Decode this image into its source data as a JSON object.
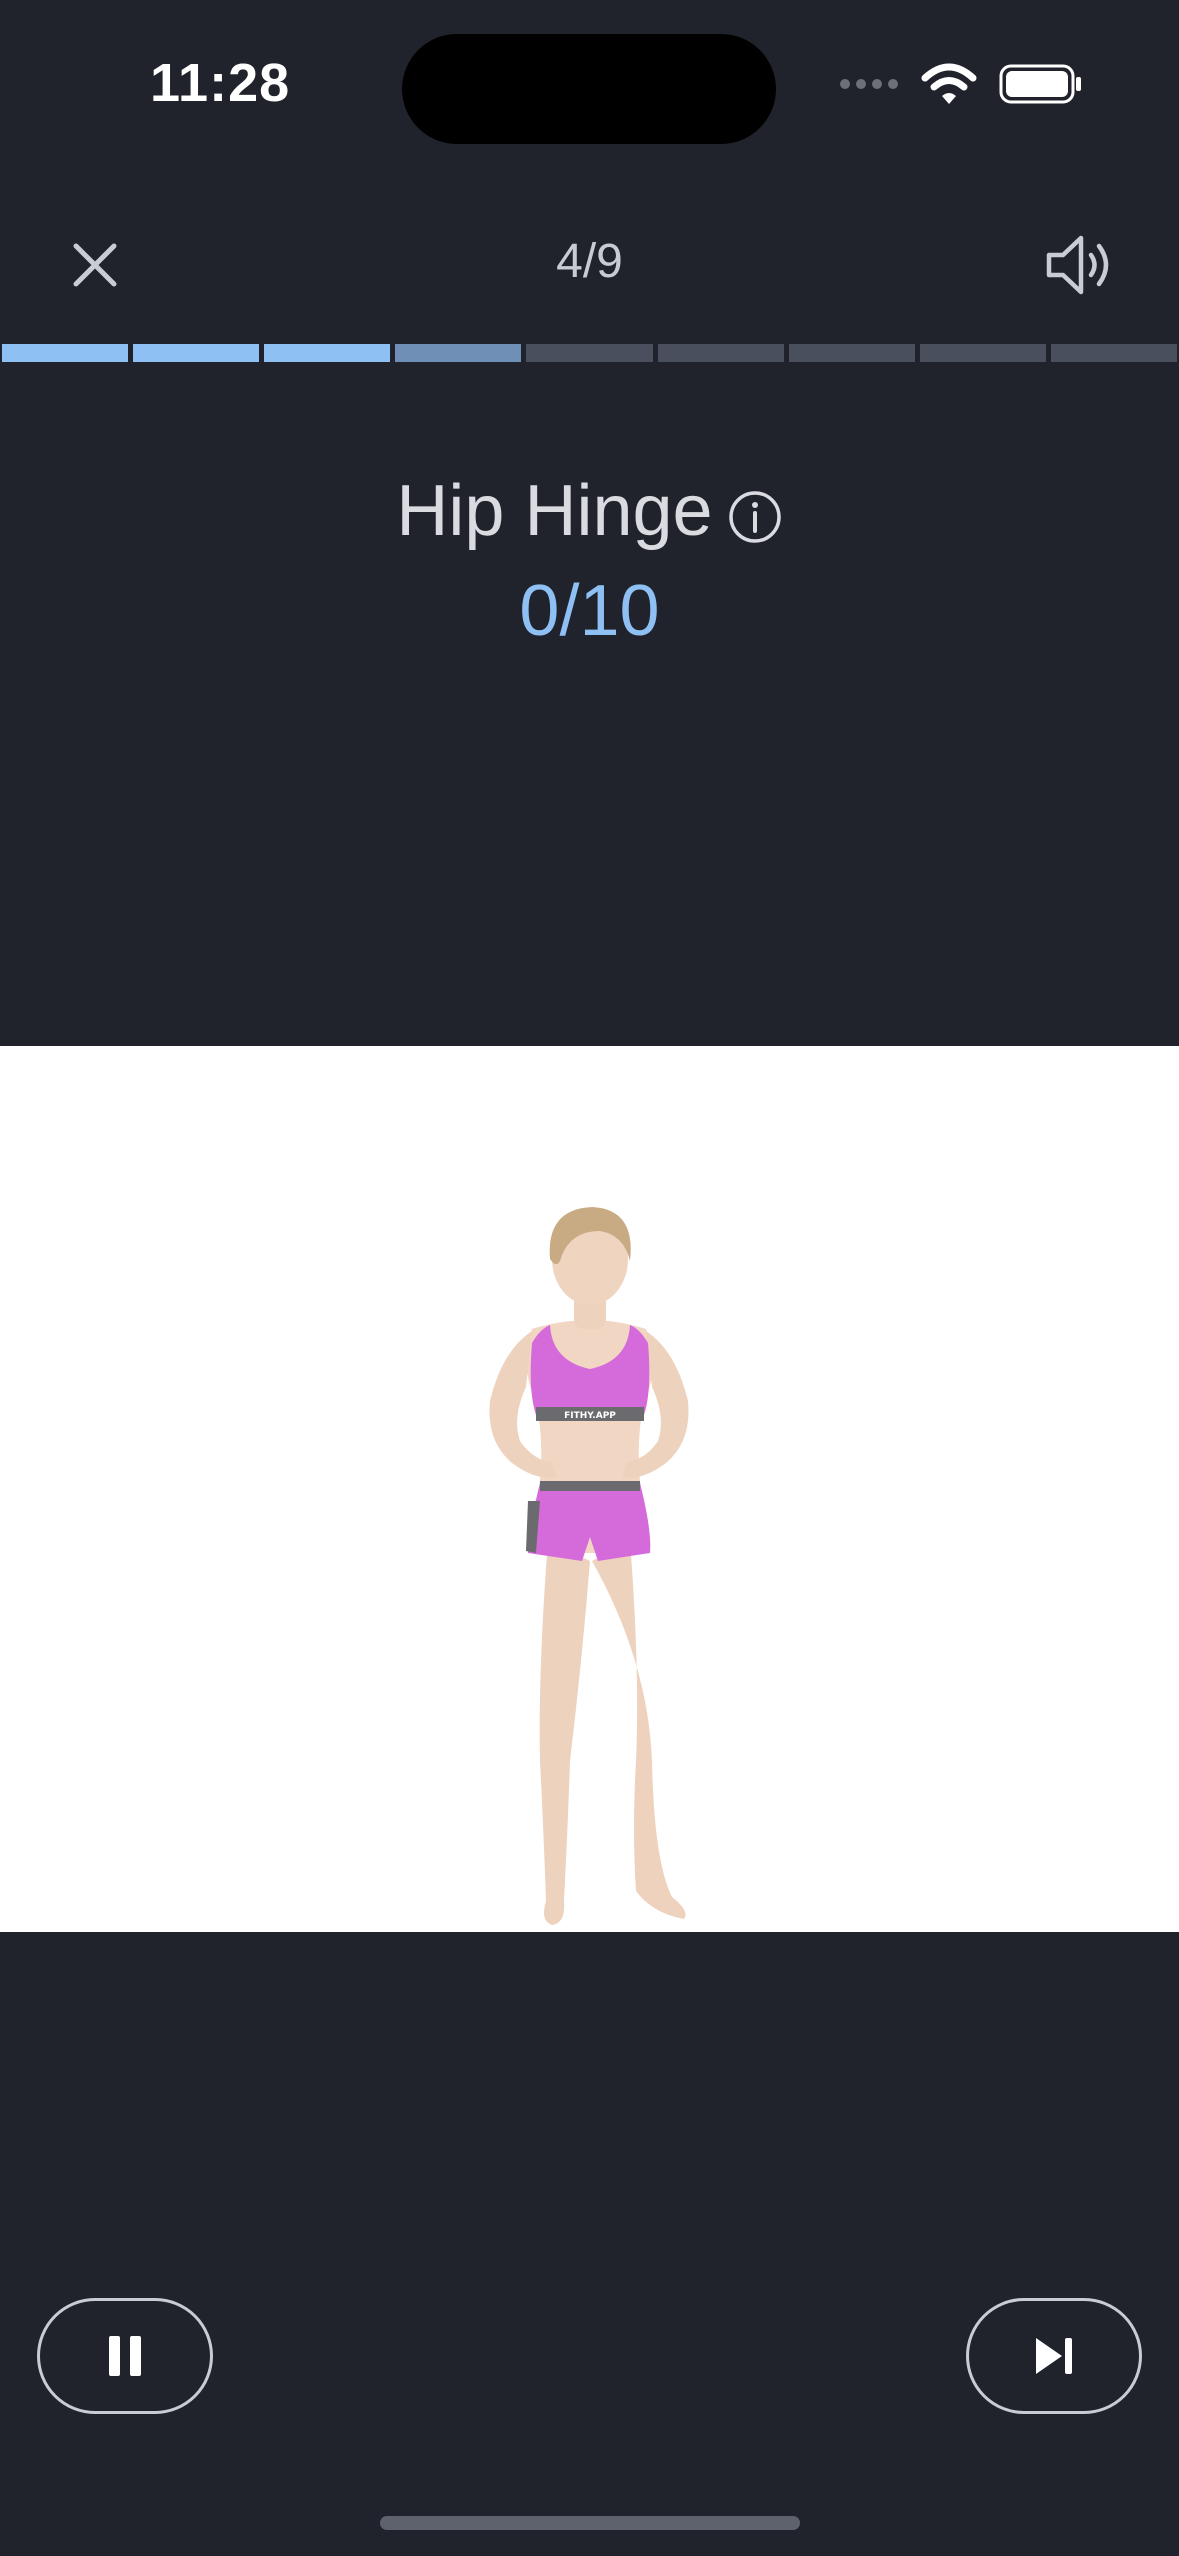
{
  "status_bar": {
    "time": "11:28"
  },
  "nav": {
    "step": "4/9"
  },
  "progress": {
    "total": 9,
    "completed": 3,
    "current": 4
  },
  "exercise": {
    "name": "Hip Hinge",
    "reps": "0/10"
  },
  "media": {
    "logo_text": "FITHY.APP"
  },
  "colors": {
    "background": "#20232c",
    "accent": "#8ec0f4",
    "current_segment": "#6f8fb7",
    "pending_segment": "#4a4f5d",
    "outfit": "#c73ad0"
  },
  "icons": {
    "close": "close-icon",
    "sound": "speaker-icon",
    "info": "info-icon",
    "pause": "pause-icon",
    "next": "skip-next-icon"
  }
}
